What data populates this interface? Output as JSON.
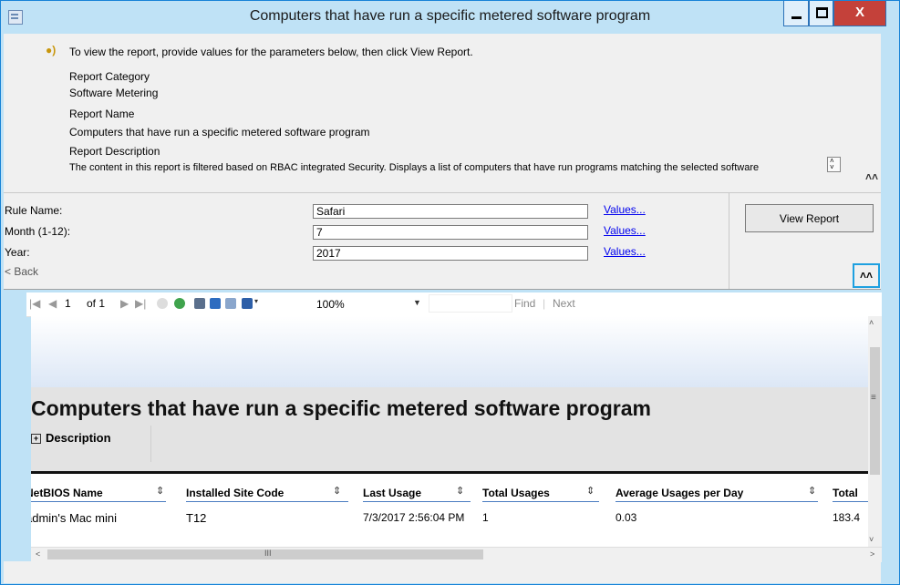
{
  "window": {
    "title": "Computers that have run a specific metered software program",
    "close_glyph": "X"
  },
  "info": {
    "instruction": "To view the report, provide values for the parameters below, then click View Report.",
    "category_label": "Report Category",
    "category_value": "Software Metering",
    "name_label": "Report Name",
    "name_value": "Computers that have run a specific metered software program",
    "description_label": "Report Description",
    "description_value": "The content in this report is filtered based on RBAC integrated Security. Displays a list of computers that have run programs matching the selected software"
  },
  "params": {
    "rule_name_label": "Rule Name:",
    "rule_name_value": "Safari",
    "month_label": "Month (1-12):",
    "month_value": "7",
    "year_label": "Year:",
    "year_value": "2017",
    "values_link": "Values...",
    "view_report_label": "View Report",
    "back_label": "< Back"
  },
  "toolbar": {
    "page_current": "1",
    "page_of": "of 1",
    "zoom": "100%",
    "find_label": "Find",
    "separator": "|",
    "next_label": "Next"
  },
  "report": {
    "title": "Computers that have run a specific metered software program",
    "description_toggle": "Description",
    "columns": [
      "NetBIOS Name",
      "Installed Site Code",
      "Last Usage",
      "Total Usages",
      "Average Usages per Day",
      "Total"
    ],
    "rows": [
      [
        "admin's Mac mini",
        "T12",
        "7/3/2017 2:56:04 PM",
        "1",
        "0.03",
        "183.4"
      ]
    ]
  },
  "scroll": {
    "hgrip": "III"
  }
}
